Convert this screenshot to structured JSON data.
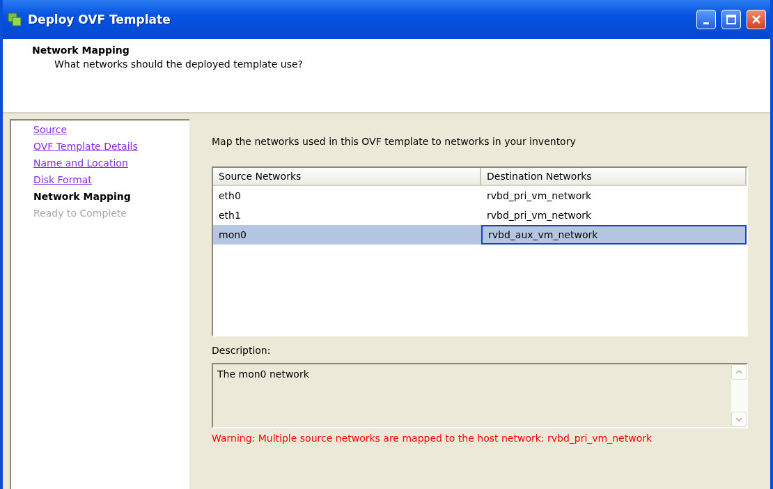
{
  "window": {
    "title": "Deploy OVF Template"
  },
  "header": {
    "title": "Network Mapping",
    "subtitle": "What networks should the deployed template use?"
  },
  "steps": [
    {
      "label": "Source",
      "kind": "done"
    },
    {
      "label": "OVF Template Details",
      "kind": "done"
    },
    {
      "label": "Name and Location",
      "kind": "done"
    },
    {
      "label": "Disk Format",
      "kind": "done"
    },
    {
      "label": "Network Mapping",
      "kind": "current"
    },
    {
      "label": "Ready to Complete",
      "kind": "pending"
    }
  ],
  "intro": "Map the networks used in this OVF template to networks in your inventory",
  "table": {
    "columns": [
      "Source Networks",
      "Destination Networks"
    ],
    "rows": [
      {
        "source": "eth0",
        "destination": "rvbd_pri_vm_network",
        "selected": false
      },
      {
        "source": "eth1",
        "destination": "rvbd_pri_vm_network",
        "selected": false
      },
      {
        "source": "mon0",
        "destination": "rvbd_aux_vm_network",
        "selected": true
      }
    ]
  },
  "description": {
    "label": "Description:",
    "value": "The mon0 network"
  },
  "warning": "Warning: Multiple source networks are mapped to the host network: rvbd_pri_vm_network"
}
